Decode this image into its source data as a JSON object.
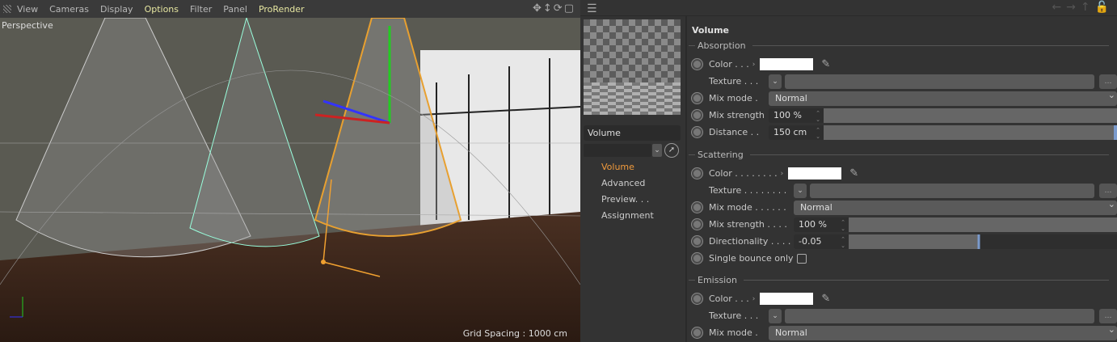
{
  "viewport": {
    "menu": [
      "View",
      "Cameras",
      "Display",
      "Options",
      "Filter",
      "Panel",
      "ProRender"
    ],
    "highlighted": [
      "Options",
      "ProRender"
    ],
    "camera_label": "Perspective",
    "grid_spacing": "Grid Spacing : 1000 cm"
  },
  "material": {
    "name": "Volume",
    "nav": [
      "Volume",
      "Advanced",
      "Preview. . .",
      "Assignment"
    ],
    "active_nav": "Volume"
  },
  "attributes": {
    "title": "Volume",
    "absorption": {
      "label": "Absorption",
      "color_label": "Color . . .",
      "color": "#ffffff",
      "texture_label": "Texture . . .",
      "mix_mode_label": "Mix mode .",
      "mix_mode": "Normal",
      "mix_strength_label": "Mix strength",
      "mix_strength": "100 %",
      "mix_strength_fraction": 1.0,
      "distance_label": "Distance . .",
      "distance": "150 cm"
    },
    "scattering": {
      "label": "Scattering",
      "color_label": "Color . . . . . . . .",
      "color": "#ffffff",
      "texture_label": "Texture . . . . . . . .",
      "mix_mode_label": "Mix mode . . . . . .",
      "mix_mode": "Normal",
      "mix_strength_label": "Mix strength . . . .",
      "mix_strength": "100 %",
      "directionality_label": "Directionality . . . .",
      "directionality": "-0.05",
      "single_bounce_label": "Single bounce only",
      "single_bounce": false
    },
    "emission": {
      "label": "Emission",
      "color_label": "Color . . .",
      "color": "#ffffff",
      "texture_label": "Texture . . .",
      "mix_mode_label": "Mix mode .",
      "mix_mode": "Normal"
    }
  }
}
